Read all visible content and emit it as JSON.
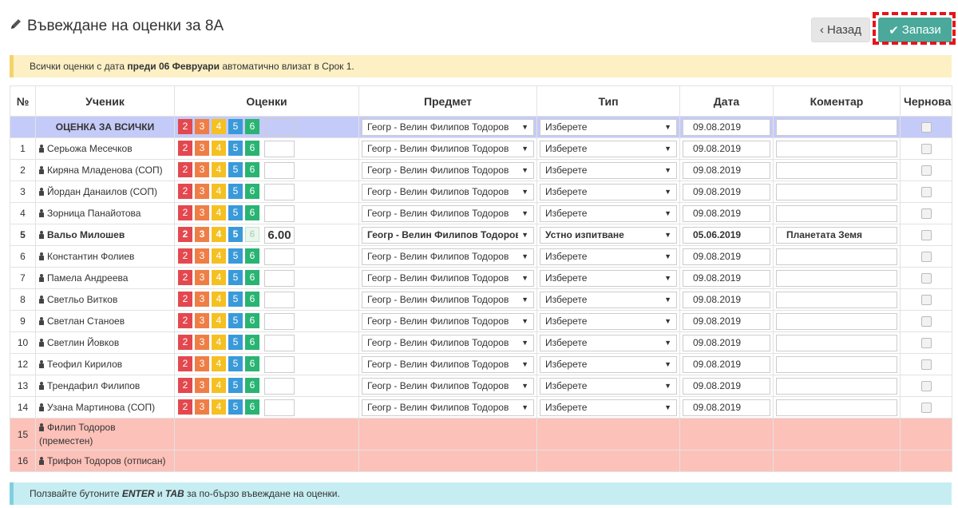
{
  "header": {
    "title": "Въвеждане на оценки за 8А",
    "back_label": "Назад",
    "save_label": "Запази"
  },
  "alert_top": {
    "prefix": "Всички оценки с дата ",
    "bold": "преди 06 Февруари",
    "suffix": " автоматично влизат в Срок 1."
  },
  "alert_bottom": {
    "prefix": "Ползвайте бутоните ",
    "key1": "ENTER",
    "middle": " и ",
    "key2": "TAB",
    "suffix": " за по-бързо въвеждане на оценки."
  },
  "columns": [
    "№",
    "Ученик",
    "Оценки",
    "Предмет",
    "Тип",
    "Дата",
    "Коментар",
    "Чернова"
  ],
  "grade_buttons": [
    "2",
    "3",
    "4",
    "5",
    "6"
  ],
  "default_subject": "Геогр - Велин Филипов Тодоров",
  "default_type": "Изберете",
  "default_date": "09.08.2019",
  "all_row": {
    "label": "ОЦЕНКА ЗА ВСИЧКИ"
  },
  "students": [
    {
      "num": "1",
      "name": "Серьожа Месечков"
    },
    {
      "num": "2",
      "name": "Киряна Младенова (СОП)"
    },
    {
      "num": "3",
      "name": "Йордан Данаилов (СОП)"
    },
    {
      "num": "4",
      "name": "Зорница Панайотова"
    },
    {
      "num": "5",
      "name": "Вальо Милошев",
      "grade": "6.00",
      "subject": "Геогр - Велин Филипов Тодоров",
      "type": "Устно изпитване",
      "date": "05.06.2019",
      "comment": "Планетата Земя",
      "highlight": true
    },
    {
      "num": "6",
      "name": "Константин Фолиев"
    },
    {
      "num": "7",
      "name": "Памела Андреева"
    },
    {
      "num": "8",
      "name": "Светльо Витков"
    },
    {
      "num": "9",
      "name": "Светлан Станоев"
    },
    {
      "num": "10",
      "name": "Светлин Йовков"
    },
    {
      "num": "12",
      "name": "Теофил Кирилов"
    },
    {
      "num": "13",
      "name": "Трендафил Филипов"
    },
    {
      "num": "14",
      "name": "Узана Мартинова (СОП)"
    }
  ],
  "removed": [
    {
      "num": "15",
      "name": "Филип Тодоров (преместен)"
    },
    {
      "num": "16",
      "name": "Трифон Тодоров (отписан)"
    }
  ]
}
